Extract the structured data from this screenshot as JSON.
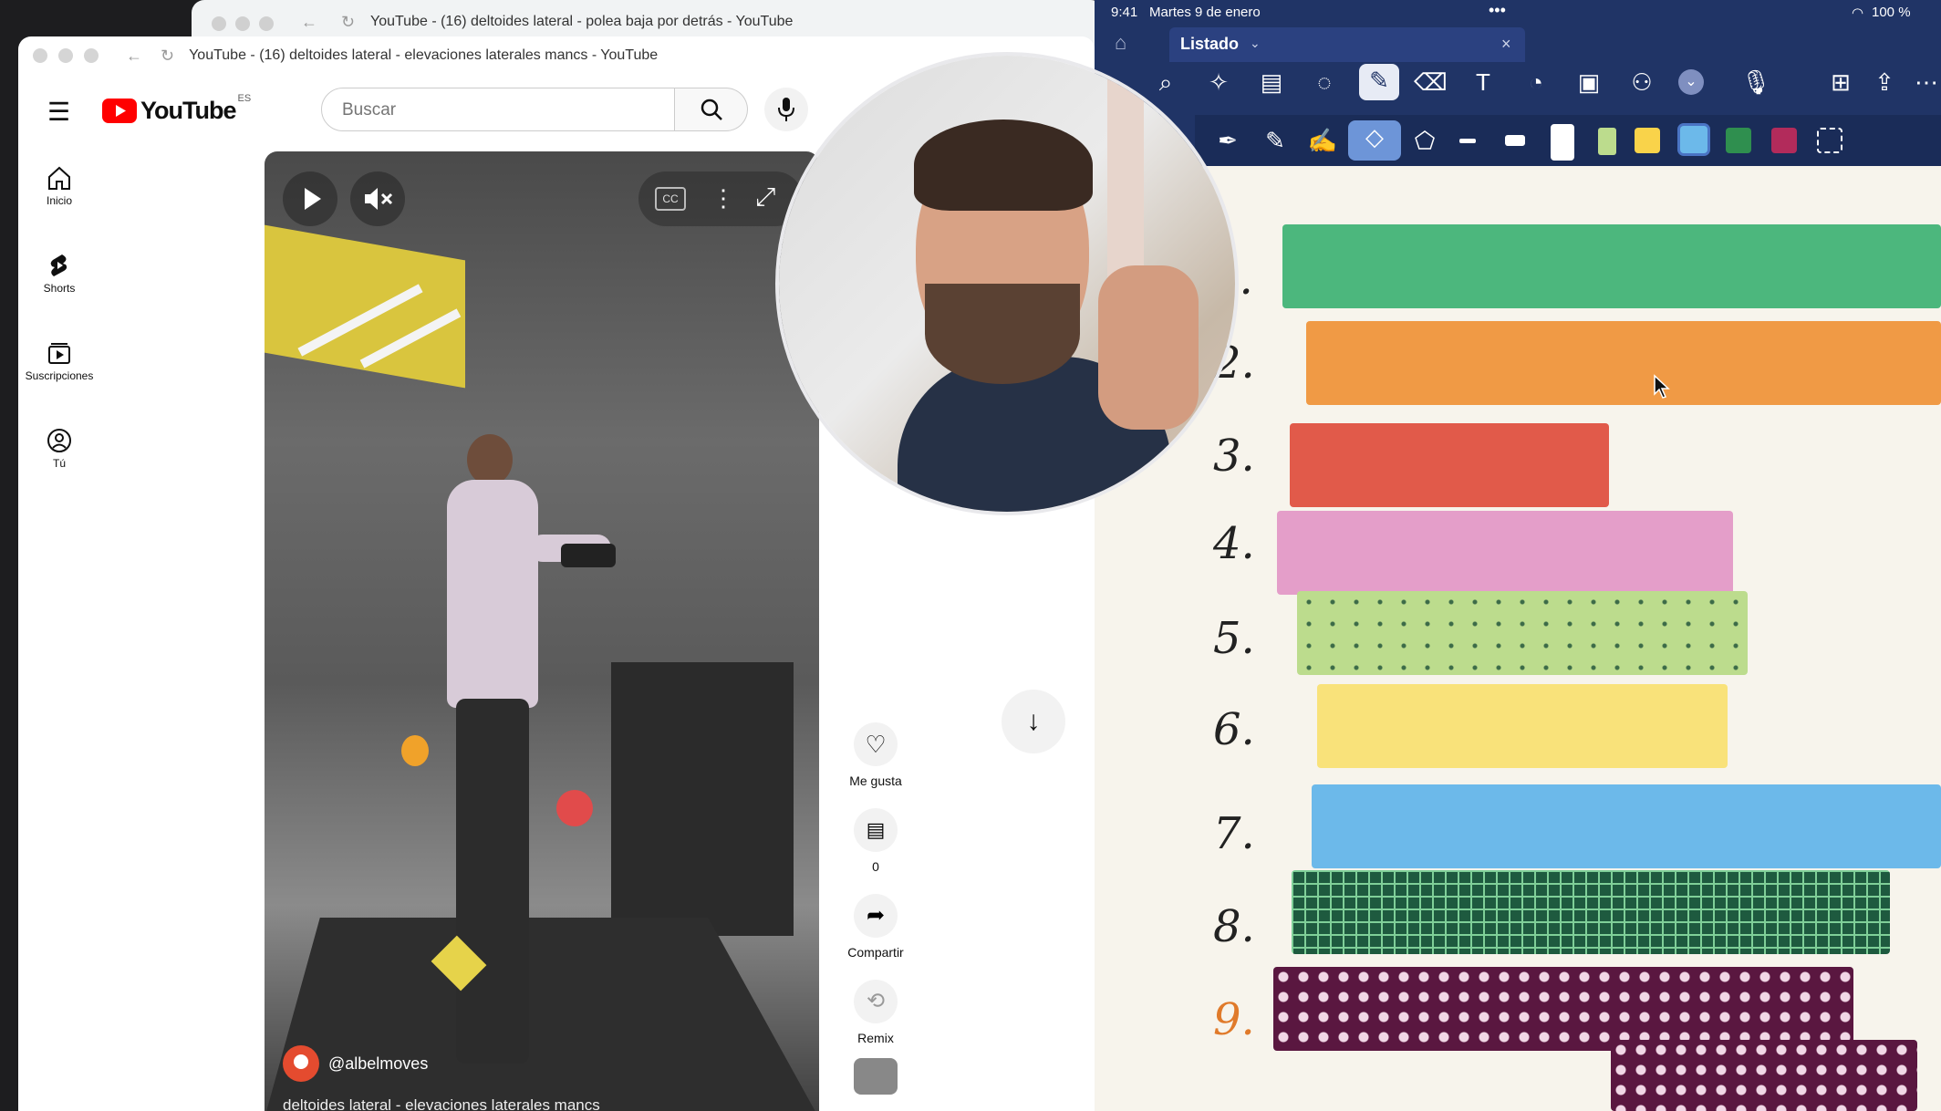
{
  "back_browser": {
    "title": "YouTube - (16) deltoides lateral - polea baja por detrás - YouTube"
  },
  "front_browser": {
    "title": "YouTube - (16) deltoides lateral - elevaciones laterales mancs - YouTube"
  },
  "youtube": {
    "logo_text": "YouTube",
    "region_badge": "ES",
    "search_placeholder": "Buscar",
    "nav": [
      {
        "label": "Inicio",
        "icon": "home-icon"
      },
      {
        "label": "Shorts",
        "icon": "shorts-icon"
      },
      {
        "label": "Suscripciones",
        "icon": "subscriptions-icon"
      },
      {
        "label": "Tú",
        "icon": "you-icon"
      }
    ],
    "video": {
      "channel": "@albelmoves",
      "title": "deltoides lateral - elevaciones laterales mancs",
      "cc_label": "CC"
    },
    "actions": {
      "like_label": "Me gusta",
      "comments_count": "0",
      "share_label": "Compartir",
      "remix_label": "Remix"
    }
  },
  "notes_app": {
    "status_time": "9:41",
    "status_date": "Martes 9 de enero",
    "battery": "100 %",
    "tab_title": "Listado",
    "numbers": [
      "1.",
      "2.",
      "3.",
      "4.",
      "5.",
      "6.",
      "7.",
      "8.",
      "9."
    ],
    "colors": {
      "green": "#4cb77d",
      "orange": "#f09a45",
      "red": "#e15a4a",
      "pink": "#e49ec9",
      "lime": "#bcdc8d",
      "yellow": "#f9e27a",
      "blue": "#6cb9ea",
      "dark_green": "#1e5a3f",
      "purple": "#5a1740"
    }
  }
}
